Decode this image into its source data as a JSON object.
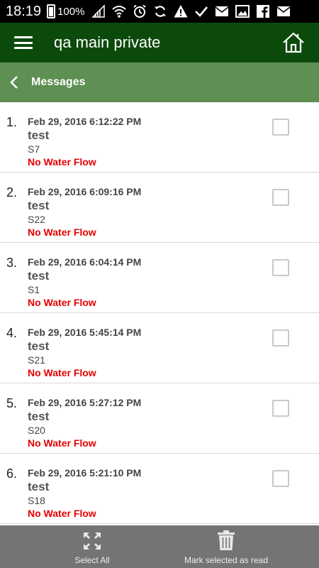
{
  "status_bar": {
    "time": "18:19",
    "battery_percent": "100%",
    "icons": [
      "signal-icon",
      "wifi-icon",
      "alarm-icon",
      "sync-icon",
      "warning-icon",
      "check-icon",
      "mail-icon",
      "image-icon",
      "facebook-icon",
      "mail-icon"
    ]
  },
  "app_bar": {
    "title": "qa main private",
    "background": "#0c4a0c"
  },
  "sub_header": {
    "title": "Messages",
    "background": "#5e8f53"
  },
  "messages": [
    {
      "number": "1.",
      "date": "Feb 29, 2016 6:12:22 PM",
      "title": "test",
      "sensor": "S7",
      "alert": "No Water Flow"
    },
    {
      "number": "2.",
      "date": "Feb 29, 2016 6:09:16 PM",
      "title": "test",
      "sensor": "S22",
      "alert": "No Water Flow"
    },
    {
      "number": "3.",
      "date": "Feb 29, 2016 6:04:14 PM",
      "title": "test",
      "sensor": "S1",
      "alert": "No Water Flow"
    },
    {
      "number": "4.",
      "date": "Feb 29, 2016 5:45:14 PM",
      "title": "test",
      "sensor": "S21",
      "alert": "No Water Flow"
    },
    {
      "number": "5.",
      "date": "Feb 29, 2016 5:27:12 PM",
      "title": "test",
      "sensor": "S20",
      "alert": "No Water Flow"
    },
    {
      "number": "6.",
      "date": "Feb 29, 2016 5:21:10 PM",
      "title": "test",
      "sensor": "S18",
      "alert": "No Water Flow"
    }
  ],
  "bottom_bar": {
    "select_all_label": "Select All",
    "mark_read_label": "Mark selected as read",
    "background": "#747474"
  },
  "colors": {
    "alert": "#e60000"
  }
}
